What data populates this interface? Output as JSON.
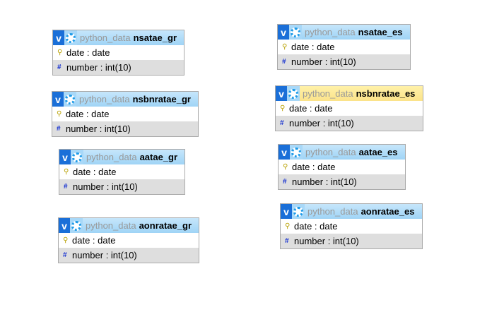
{
  "database": "python_data",
  "highlight_color": "#fbe38a",
  "tables": [
    {
      "name": "nsatae_gr",
      "highlighted": false,
      "columns": [
        {
          "icon": "key-icon",
          "label": "date : date"
        },
        {
          "icon": "hash-icon",
          "label": "number : int(10)"
        }
      ]
    },
    {
      "name": "nsbnratae_gr",
      "highlighted": false,
      "columns": [
        {
          "icon": "key-icon",
          "label": "date : date"
        },
        {
          "icon": "hash-icon",
          "label": "number : int(10)"
        }
      ]
    },
    {
      "name": "aatae_gr",
      "highlighted": false,
      "columns": [
        {
          "icon": "key-icon",
          "label": "date : date"
        },
        {
          "icon": "hash-icon",
          "label": "number : int(10)"
        }
      ]
    },
    {
      "name": "aonratae_gr",
      "highlighted": false,
      "columns": [
        {
          "icon": "key-icon",
          "label": "date : date"
        },
        {
          "icon": "hash-icon",
          "label": "number : int(10)"
        }
      ]
    },
    {
      "name": "nsatae_es",
      "highlighted": false,
      "columns": [
        {
          "icon": "key-icon",
          "label": "date : date"
        },
        {
          "icon": "hash-icon",
          "label": "number : int(10)"
        }
      ]
    },
    {
      "name": "nsbnratae_es",
      "highlighted": true,
      "columns": [
        {
          "icon": "key-icon",
          "label": "date : date"
        },
        {
          "icon": "hash-icon",
          "label": "number : int(10)"
        }
      ]
    },
    {
      "name": "aatae_es",
      "highlighted": false,
      "columns": [
        {
          "icon": "key-icon",
          "label": "date : date"
        },
        {
          "icon": "hash-icon",
          "label": "number : int(10)"
        }
      ]
    },
    {
      "name": "aonratae_es",
      "highlighted": false,
      "columns": [
        {
          "icon": "key-icon",
          "label": "date : date"
        },
        {
          "icon": "hash-icon",
          "label": "number : int(10)"
        }
      ]
    }
  ]
}
